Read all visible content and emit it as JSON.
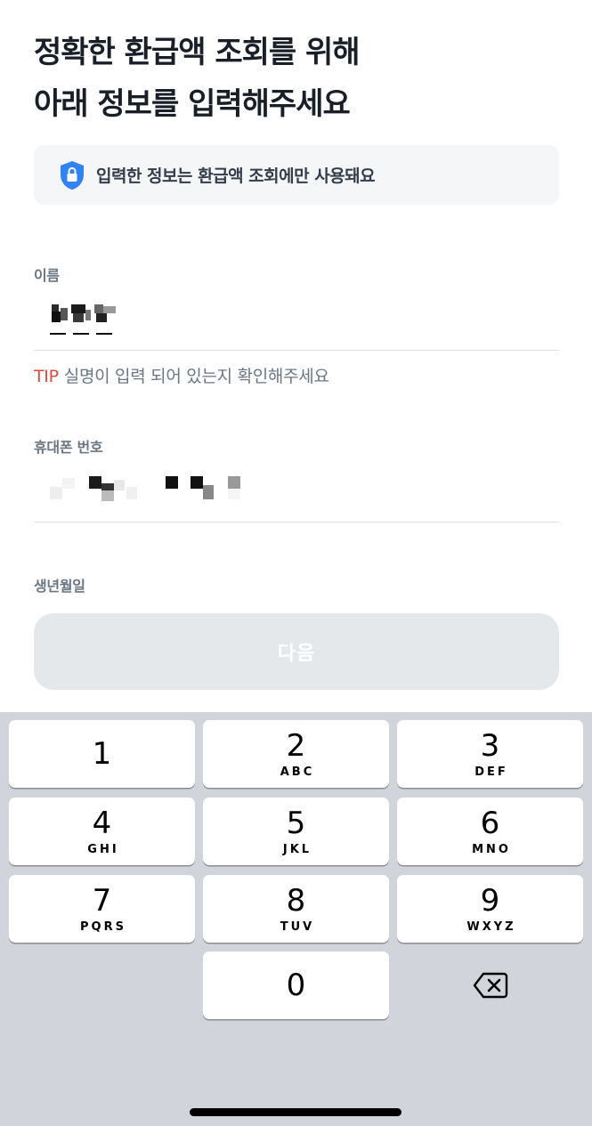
{
  "header": {
    "title_line1": "정확한 환급액 조회를 위해",
    "title_line2": "아래 정보를 입력해주세요"
  },
  "notice": {
    "icon": "shield-lock-icon",
    "text": "입력한 정보는 환급액 조회에만 사용돼요",
    "accent": "#3182f6"
  },
  "name_field": {
    "label": "이름"
  },
  "tip": {
    "tag": "TIP",
    "text": "실명이 입력 되어 있는지 확인해주세요",
    "tag_color": "#e2483d"
  },
  "phone_field": {
    "label": "휴대폰 번호"
  },
  "birth_field": {
    "label": "생년월일"
  },
  "next_button": {
    "label": "다음"
  },
  "keyboard": {
    "keys": [
      {
        "num": "1",
        "letters": ""
      },
      {
        "num": "2",
        "letters": "ABC"
      },
      {
        "num": "3",
        "letters": "DEF"
      },
      {
        "num": "4",
        "letters": "GHI"
      },
      {
        "num": "5",
        "letters": "JKL"
      },
      {
        "num": "6",
        "letters": "MNO"
      },
      {
        "num": "7",
        "letters": "PQRS"
      },
      {
        "num": "8",
        "letters": "TUV"
      },
      {
        "num": "9",
        "letters": "WXYZ"
      },
      {
        "num": "0",
        "letters": ""
      }
    ],
    "delete_icon": "backspace-icon"
  }
}
